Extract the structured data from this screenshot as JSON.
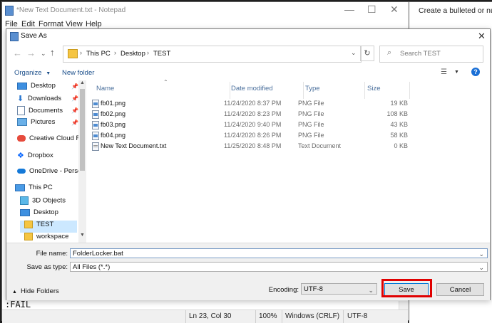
{
  "notepad": {
    "title": "*New Text Document.txt - Notepad",
    "menu": [
      "File",
      "Edit",
      "Format",
      "View",
      "Help"
    ],
    "text_visible": ":FAIL",
    "statusbar": {
      "position": "Ln 23, Col 30",
      "zoom": "100%",
      "line_ending": "Windows (CRLF)",
      "encoding": "UTF-8"
    }
  },
  "right_panel": {
    "text": "Create a bulleted or num"
  },
  "dialog": {
    "title": "Save As",
    "close_glyph": "✕",
    "breadcrumb": [
      "This PC",
      "Desktop",
      "TEST"
    ],
    "search_placeholder": "Search TEST",
    "toolbar": {
      "organize_label": "Organize",
      "new_folder_label": "New folder"
    },
    "nav_items": [
      {
        "label": "Desktop",
        "icon": "desktop-icon",
        "pinned": true
      },
      {
        "label": "Downloads",
        "icon": "download-icon",
        "pinned": true
      },
      {
        "label": "Documents",
        "icon": "documents-icon",
        "pinned": true
      },
      {
        "label": "Pictures",
        "icon": "pictures-icon",
        "pinned": true
      },
      {
        "label": "Creative Cloud Fil",
        "icon": "creative-cloud-icon",
        "pinned": false
      },
      {
        "label": "Dropbox",
        "icon": "dropbox-icon",
        "pinned": false
      },
      {
        "label": "OneDrive - Person",
        "icon": "onedrive-icon",
        "pinned": false
      },
      {
        "label": "This PC",
        "icon": "this-pc-icon",
        "pinned": false
      },
      {
        "label": "3D Objects",
        "icon": "3d-objects-icon",
        "pinned": false
      },
      {
        "label": "Desktop",
        "icon": "desktop-icon",
        "pinned": false
      },
      {
        "label": "TEST",
        "icon": "folder-icon",
        "pinned": false,
        "selected": true
      },
      {
        "label": "workspace",
        "icon": "folder-icon",
        "pinned": false
      }
    ],
    "columns": {
      "name": "Name",
      "date": "Date modified",
      "type": "Type",
      "size": "Size"
    },
    "files": [
      {
        "name": "fb01.png",
        "date": "11/24/2020 8:37 PM",
        "type": "PNG File",
        "size": "19 KB",
        "kind": "png"
      },
      {
        "name": "fb02.png",
        "date": "11/24/2020 8:23 PM",
        "type": "PNG File",
        "size": "108 KB",
        "kind": "png"
      },
      {
        "name": "fb03.png",
        "date": "11/24/2020 9:40 PM",
        "type": "PNG File",
        "size": "43 KB",
        "kind": "png"
      },
      {
        "name": "fb04.png",
        "date": "11/24/2020 8:26 PM",
        "type": "PNG File",
        "size": "58 KB",
        "kind": "png"
      },
      {
        "name": "New Text Document.txt",
        "date": "11/25/2020 8:48 PM",
        "type": "Text Document",
        "size": "0 KB",
        "kind": "txt"
      }
    ],
    "file_name_label": "File name:",
    "file_name_value": "FolderLocker.bat",
    "save_as_type_label": "Save as type:",
    "save_as_type_value": "All Files  (*.*)",
    "hide_folders_label": "Hide Folders",
    "encoding_label": "Encoding:",
    "encoding_value": "UTF-8",
    "save_label": "Save",
    "cancel_label": "Cancel"
  },
  "colors": {
    "highlight_box": "#e00000",
    "selected_nav": "#cce8ff",
    "header_text": "#4a6f9c"
  }
}
